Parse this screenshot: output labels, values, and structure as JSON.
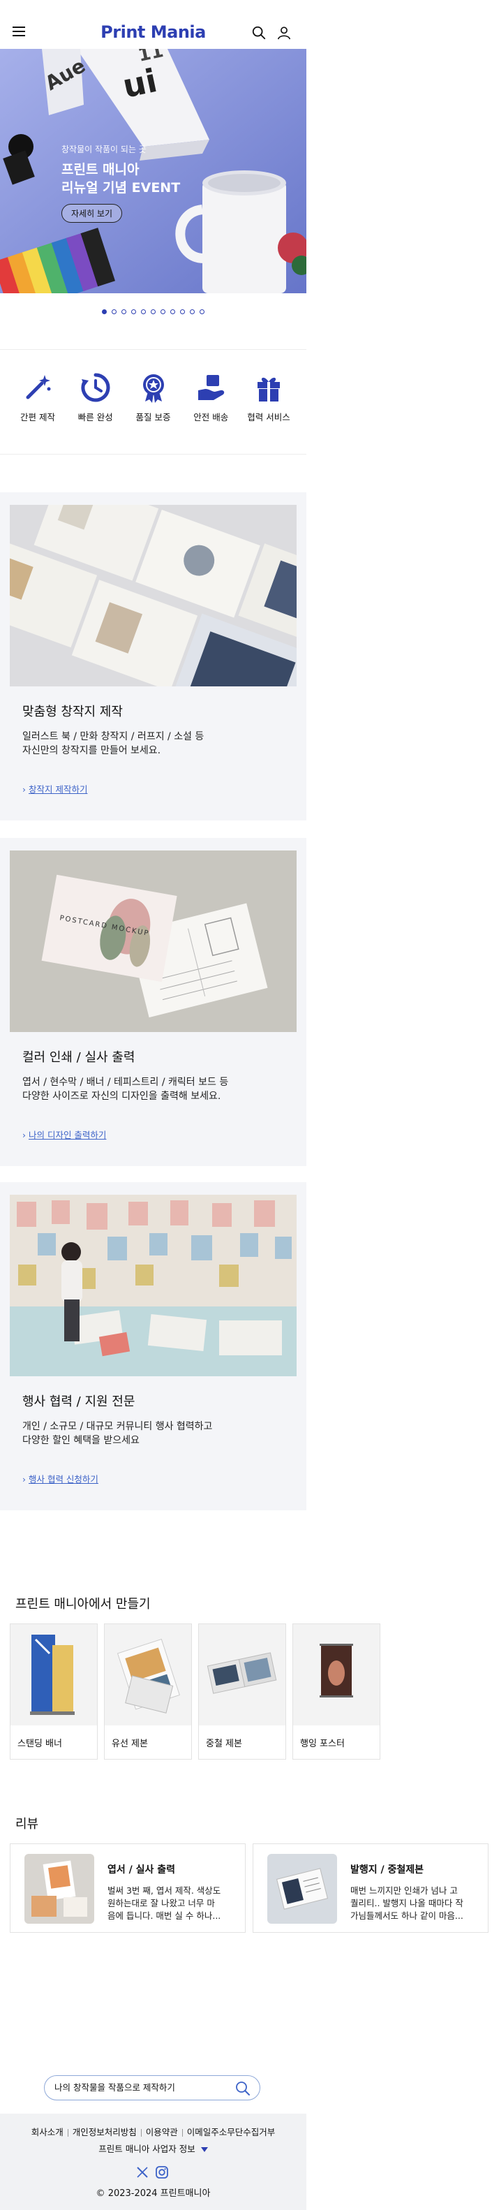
{
  "header": {
    "logo": "Print Mania",
    "icons": [
      "menu-icon",
      "search-icon",
      "user-icon"
    ]
  },
  "hero": {
    "subtitle": "창작물이 작품이 되는 곳",
    "title_line1": "프린트 매니아",
    "title_line2": "리뉴얼 기념 EVENT",
    "button": "자세히 보기",
    "slide_count": 11,
    "active_slide": 1
  },
  "services": [
    {
      "icon": "magic-wand-icon",
      "label": "간편 제작"
    },
    {
      "icon": "fast-clock-icon",
      "label": "빠른 완성"
    },
    {
      "icon": "quality-badge-icon",
      "label": "품질 보증"
    },
    {
      "icon": "delivery-box-icon",
      "label": "안전 배송"
    },
    {
      "icon": "gift-icon",
      "label": "협력 서비스"
    }
  ],
  "features": [
    {
      "title": "맞춤형 창작지 제작",
      "desc_line1": "일러스트 북 / 만화 창작지 / 러프지 / 소설 등",
      "desc_line2": "자신만의 창작지를 만들어 보세요.",
      "link": "창작지 제작하기"
    },
    {
      "title": "컬러 인쇄 / 실사 출력",
      "desc_line1": "엽서 / 현수막 / 배너 / 테피스트리 / 캐릭터 보드 등",
      "desc_line2": "다양한 사이즈로 자신의 디자인을 출력해 보세요.",
      "link": "나의 디자인 출력하기",
      "image_text": "POSTCARD MOCKUP"
    },
    {
      "title": "행사 협력 / 지원 전문",
      "desc_line1": "개인 / 소규모 / 대규모 커뮤니티 행사 협력하고",
      "desc_line2": "다양한 할인 혜택을 받으세요",
      "link": "행사 협력 신청하기"
    }
  ],
  "products": {
    "title": "프린트 매니아에서 만들기",
    "items": [
      {
        "label": "스탠딩 배너"
      },
      {
        "label": "유선 제본"
      },
      {
        "label": "중철 제본"
      },
      {
        "label": "행잉 포스터"
      }
    ]
  },
  "reviews": {
    "title": "리뷰",
    "items": [
      {
        "title": "엽서 / 실사 출력",
        "line1": "벌써 3번 째, 엽서 제작. 색상도",
        "line2": "원하는대로 잘 나왔고 너무 마",
        "line3": "음에 듭니다. 매번 실 수 하나..."
      },
      {
        "title": "발행지 / 중철제본",
        "line1": "매번 느끼지만 인쇄가 넘나 고",
        "line2": "퀄리티.. 발행지 나올 때마다 작",
        "line3": "가님들께서도 하나 같이 마음..."
      }
    ]
  },
  "search": {
    "value": "나의 창작물을 작품으로 제작하기_"
  },
  "footer": {
    "links": [
      "회사소개",
      "개인정보처리방침",
      "이용약관",
      "이메일주소무단수집거부"
    ],
    "business_info": "프린트 매니아 사업자 정보",
    "copyright": "2023-2024 프린트매니아"
  },
  "colors": {
    "brand": "#2d3fb2",
    "link": "#3d63c8",
    "section_bg": "#f4f5f8",
    "footer_bg": "#f1f2f4"
  }
}
